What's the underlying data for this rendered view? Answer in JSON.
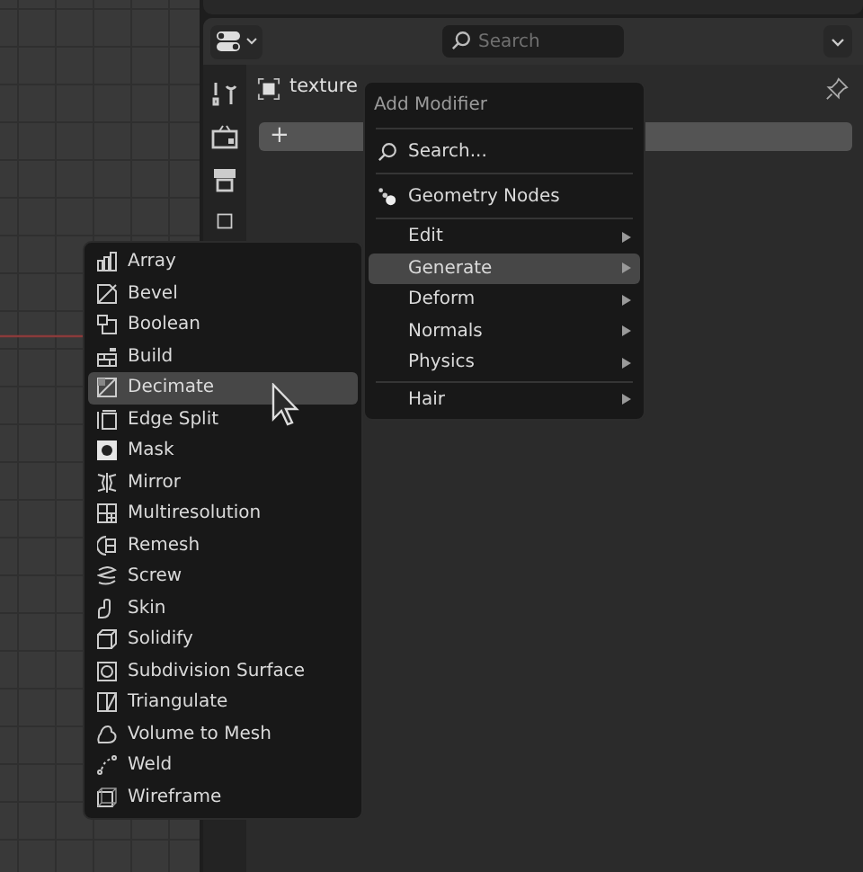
{
  "header": {
    "search": {
      "placeholder": "Search"
    }
  },
  "object": {
    "name": "texture"
  },
  "add_bar": {
    "label": "+"
  },
  "add_menu": {
    "title": "Add Modifier",
    "groups": [
      [
        {
          "kind": "search",
          "label": "Search...",
          "selected": false
        }
      ],
      [
        {
          "kind": "nodes",
          "label": "Geometry Nodes",
          "selected": false
        }
      ],
      [
        {
          "kind": "submenu",
          "label": "Edit",
          "selected": false
        },
        {
          "kind": "submenu",
          "label": "Generate",
          "selected": true
        },
        {
          "kind": "submenu",
          "label": "Deform",
          "selected": false
        },
        {
          "kind": "submenu",
          "label": "Normals",
          "selected": false
        },
        {
          "kind": "submenu",
          "label": "Physics",
          "selected": false
        }
      ],
      [
        {
          "kind": "submenu",
          "label": "Hair",
          "selected": false
        }
      ]
    ]
  },
  "generate_menu": {
    "items": [
      {
        "label": "Array",
        "selected": false
      },
      {
        "label": "Bevel",
        "selected": false
      },
      {
        "label": "Boolean",
        "selected": false
      },
      {
        "label": "Build",
        "selected": false
      },
      {
        "label": "Decimate",
        "selected": true
      },
      {
        "label": "Edge Split",
        "selected": false
      },
      {
        "label": "Mask",
        "selected": false
      },
      {
        "label": "Mirror",
        "selected": false
      },
      {
        "label": "Multiresolution",
        "selected": false
      },
      {
        "label": "Remesh",
        "selected": false
      },
      {
        "label": "Screw",
        "selected": false
      },
      {
        "label": "Skin",
        "selected": false
      },
      {
        "label": "Solidify",
        "selected": false
      },
      {
        "label": "Subdivision Surface",
        "selected": false
      },
      {
        "label": "Triangulate",
        "selected": false
      },
      {
        "label": "Volume to Mesh",
        "selected": false
      },
      {
        "label": "Weld",
        "selected": false
      },
      {
        "label": "Wireframe",
        "selected": false
      }
    ]
  }
}
